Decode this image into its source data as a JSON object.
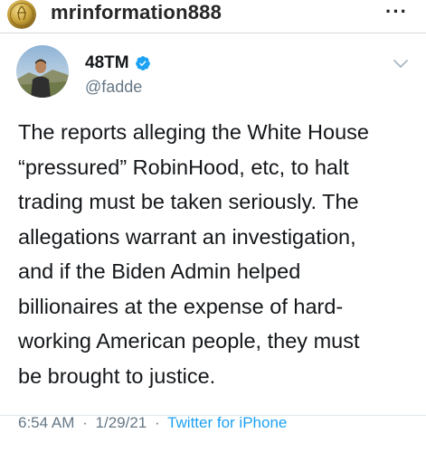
{
  "instagram": {
    "username": "mrinformation888",
    "more_label": "···"
  },
  "tweet": {
    "display_name": "48TM",
    "handle": "@fadde",
    "text_lines": [
      "The reports alleging the White House",
      "“pressured” RobinHood, etc, to halt",
      "trading must be taken seriously. The",
      "allegations warrant an investigation,",
      "and if the Biden Admin helped",
      "billionaires at the expense of hard-",
      "working American people, they must",
      "be brought to justice."
    ],
    "time": "6:54 AM",
    "separator": "·",
    "date": "1/29/21",
    "source": "Twitter for iPhone"
  },
  "colors": {
    "twitter_blue": "#1da1f2",
    "handle_gray": "#657786",
    "ig_gold": "#c8a23a"
  },
  "icons": {
    "verified": "verified-badge-icon",
    "chevron": "chevron-down-icon",
    "more": "more-options-icon"
  }
}
